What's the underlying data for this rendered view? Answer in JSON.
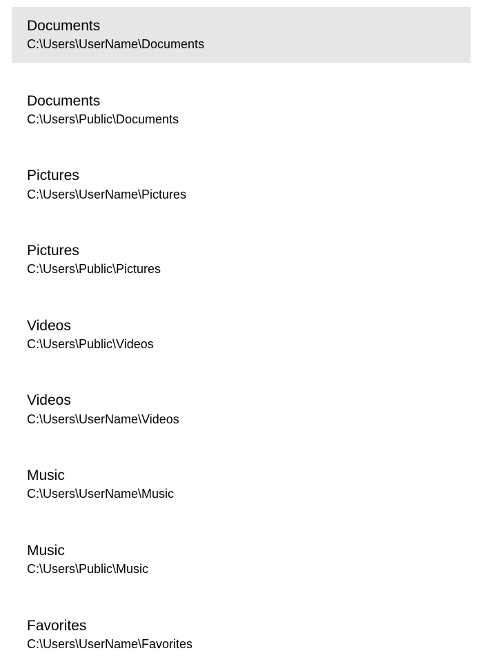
{
  "items": [
    {
      "title": "Documents",
      "path": "C:\\Users\\UserName\\Documents",
      "selected": true
    },
    {
      "title": "Documents",
      "path": "C:\\Users\\Public\\Documents",
      "selected": false
    },
    {
      "title": "Pictures",
      "path": "C:\\Users\\UserName\\Pictures",
      "selected": false
    },
    {
      "title": "Pictures",
      "path": "C:\\Users\\Public\\Pictures",
      "selected": false
    },
    {
      "title": "Videos",
      "path": "C:\\Users\\Public\\Videos",
      "selected": false
    },
    {
      "title": "Videos",
      "path": "C:\\Users\\UserName\\Videos",
      "selected": false
    },
    {
      "title": "Music",
      "path": "C:\\Users\\UserName\\Music",
      "selected": false
    },
    {
      "title": "Music",
      "path": "C:\\Users\\Public\\Music",
      "selected": false
    },
    {
      "title": "Favorites",
      "path": "C:\\Users\\UserName\\Favorites",
      "selected": false
    }
  ]
}
